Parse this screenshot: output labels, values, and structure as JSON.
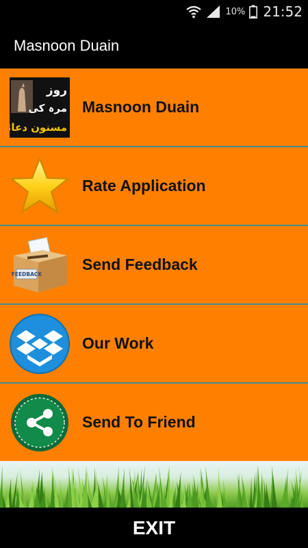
{
  "status_bar": {
    "battery_percent": "10%",
    "time": "21:52",
    "icons": [
      "wifi-icon",
      "signal-icon",
      "battery-icon"
    ]
  },
  "app_bar": {
    "title": "Masnoon Duain"
  },
  "menu": {
    "items": [
      {
        "label": "Masnoon Duain",
        "icon": "masnoon-duain-logo-icon",
        "logo_text": [
          "روز",
          "مرہ کی",
          "مسنون دعائیں"
        ]
      },
      {
        "label": "Rate Application",
        "icon": "star-icon"
      },
      {
        "label": "Send Feedback",
        "icon": "feedback-box-icon",
        "icon_text": "FEEDBACK"
      },
      {
        "label": "Our Work",
        "icon": "dropbox-icon"
      },
      {
        "label": "Send To Friend",
        "icon": "share-icon"
      }
    ]
  },
  "footer": {
    "exit_label": "EXIT"
  },
  "colors": {
    "item_background": "#ff8000",
    "divider": "#3c8d93",
    "bars": "#000000"
  }
}
